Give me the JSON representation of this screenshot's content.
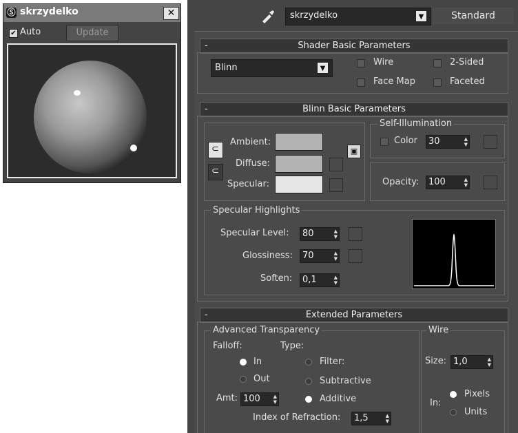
{
  "preview": {
    "title": "skrzydelko",
    "auto_label": "Auto",
    "auto_checked": true,
    "update_label": "Update",
    "close_label": "✕"
  },
  "editor": {
    "material_name": "skrzydelko",
    "material_type": "Standard",
    "shader_basic": {
      "title": "Shader Basic Parameters",
      "collapse": "-",
      "shader": "Blinn",
      "wire": "Wire",
      "two_sided": "2-Sided",
      "face_map": "Face Map",
      "faceted": "Faceted"
    },
    "blinn_basic": {
      "title": "Blinn Basic Parameters",
      "collapse": "-",
      "ambient": "Ambient:",
      "diffuse": "Diffuse:",
      "specular": "Specular:",
      "self_illum_title": "Self-Illumination",
      "color_label": "Color",
      "color_value": "30",
      "opacity_label": "Opacity:",
      "opacity_value": "100",
      "spec_highlights_title": "Specular Highlights",
      "spec_level_label": "Specular Level:",
      "spec_level_value": "80",
      "glossiness_label": "Glossiness:",
      "glossiness_value": "70",
      "soften_label": "Soften:",
      "soften_value": "0,1"
    },
    "extended": {
      "title": "Extended Parameters",
      "collapse": "-",
      "adv_transparency_title": "Advanced Transparency",
      "falloff_label": "Falloff:",
      "type_label": "Type:",
      "in_label": "In",
      "out_label": "Out",
      "filter_label": "Filter:",
      "subtractive_label": "Subtractive",
      "additive_label": "Additive",
      "amt_label": "Amt:",
      "amt_value": "100",
      "ior_label": "Index of Refraction:",
      "ior_value": "1,5",
      "wire_title": "Wire",
      "size_label": "Size:",
      "size_value": "1,0",
      "in_units_label": "In:",
      "pixels_label": "Pixels",
      "units_label": "Units"
    }
  },
  "colors": {
    "ambient": "#b3b3b3",
    "diffuse": "#b3b3b3",
    "specular": "#e6e6e6"
  }
}
